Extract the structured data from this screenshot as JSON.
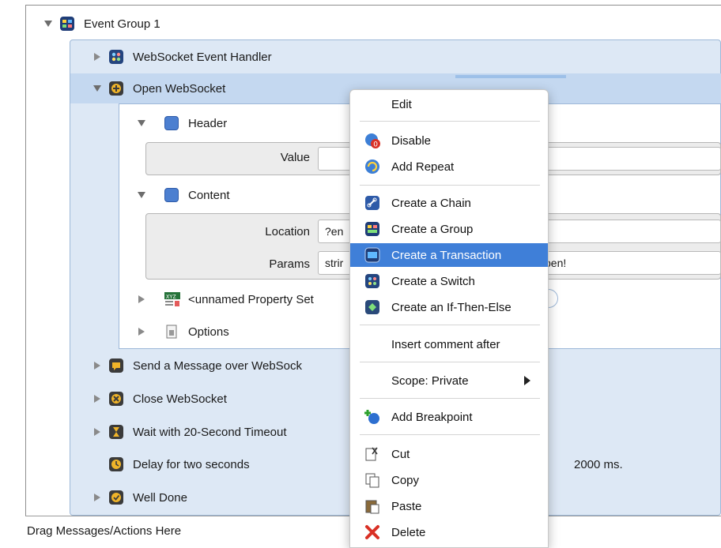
{
  "tree": {
    "event_group": "Event Group 1",
    "websocket_handler": "WebSocket Event Handler",
    "open_websocket": "Open WebSocket",
    "header": "Header",
    "value_label": "Value",
    "content": "Content",
    "location_label": "Location",
    "location_value": "?en",
    "params_label": "Params",
    "params_value": "strir",
    "params_value_tail": "pen!",
    "property_set": "<unnamed Property Set",
    "options": "Options",
    "send_message": "Send a Message over WebSock",
    "close_websocket": "Close WebSocket",
    "wait_timeout": "Wait with 20-Second Timeout",
    "delay": "Delay for two seconds",
    "delay_value": "2000 ms.",
    "well_done": "Well Done",
    "drag_hint": "Drag Messages/Actions Here"
  },
  "context_menu": {
    "edit": "Edit",
    "disable": "Disable",
    "add_repeat": "Add Repeat",
    "create_chain": "Create a Chain",
    "create_group": "Create a Group",
    "create_transaction": "Create a Transaction",
    "create_switch": "Create a Switch",
    "create_if_then_else": "Create an If-Then-Else",
    "insert_comment_after": "Insert comment after",
    "scope": "Scope: Private",
    "add_breakpoint": "Add Breakpoint",
    "cut": "Cut",
    "copy": "Copy",
    "paste": "Paste",
    "delete": "Delete"
  },
  "colors": {
    "panel_bg": "#dde8f5",
    "selected_row": "#c4d8f0",
    "menu_highlight": "#3f7fd8"
  }
}
